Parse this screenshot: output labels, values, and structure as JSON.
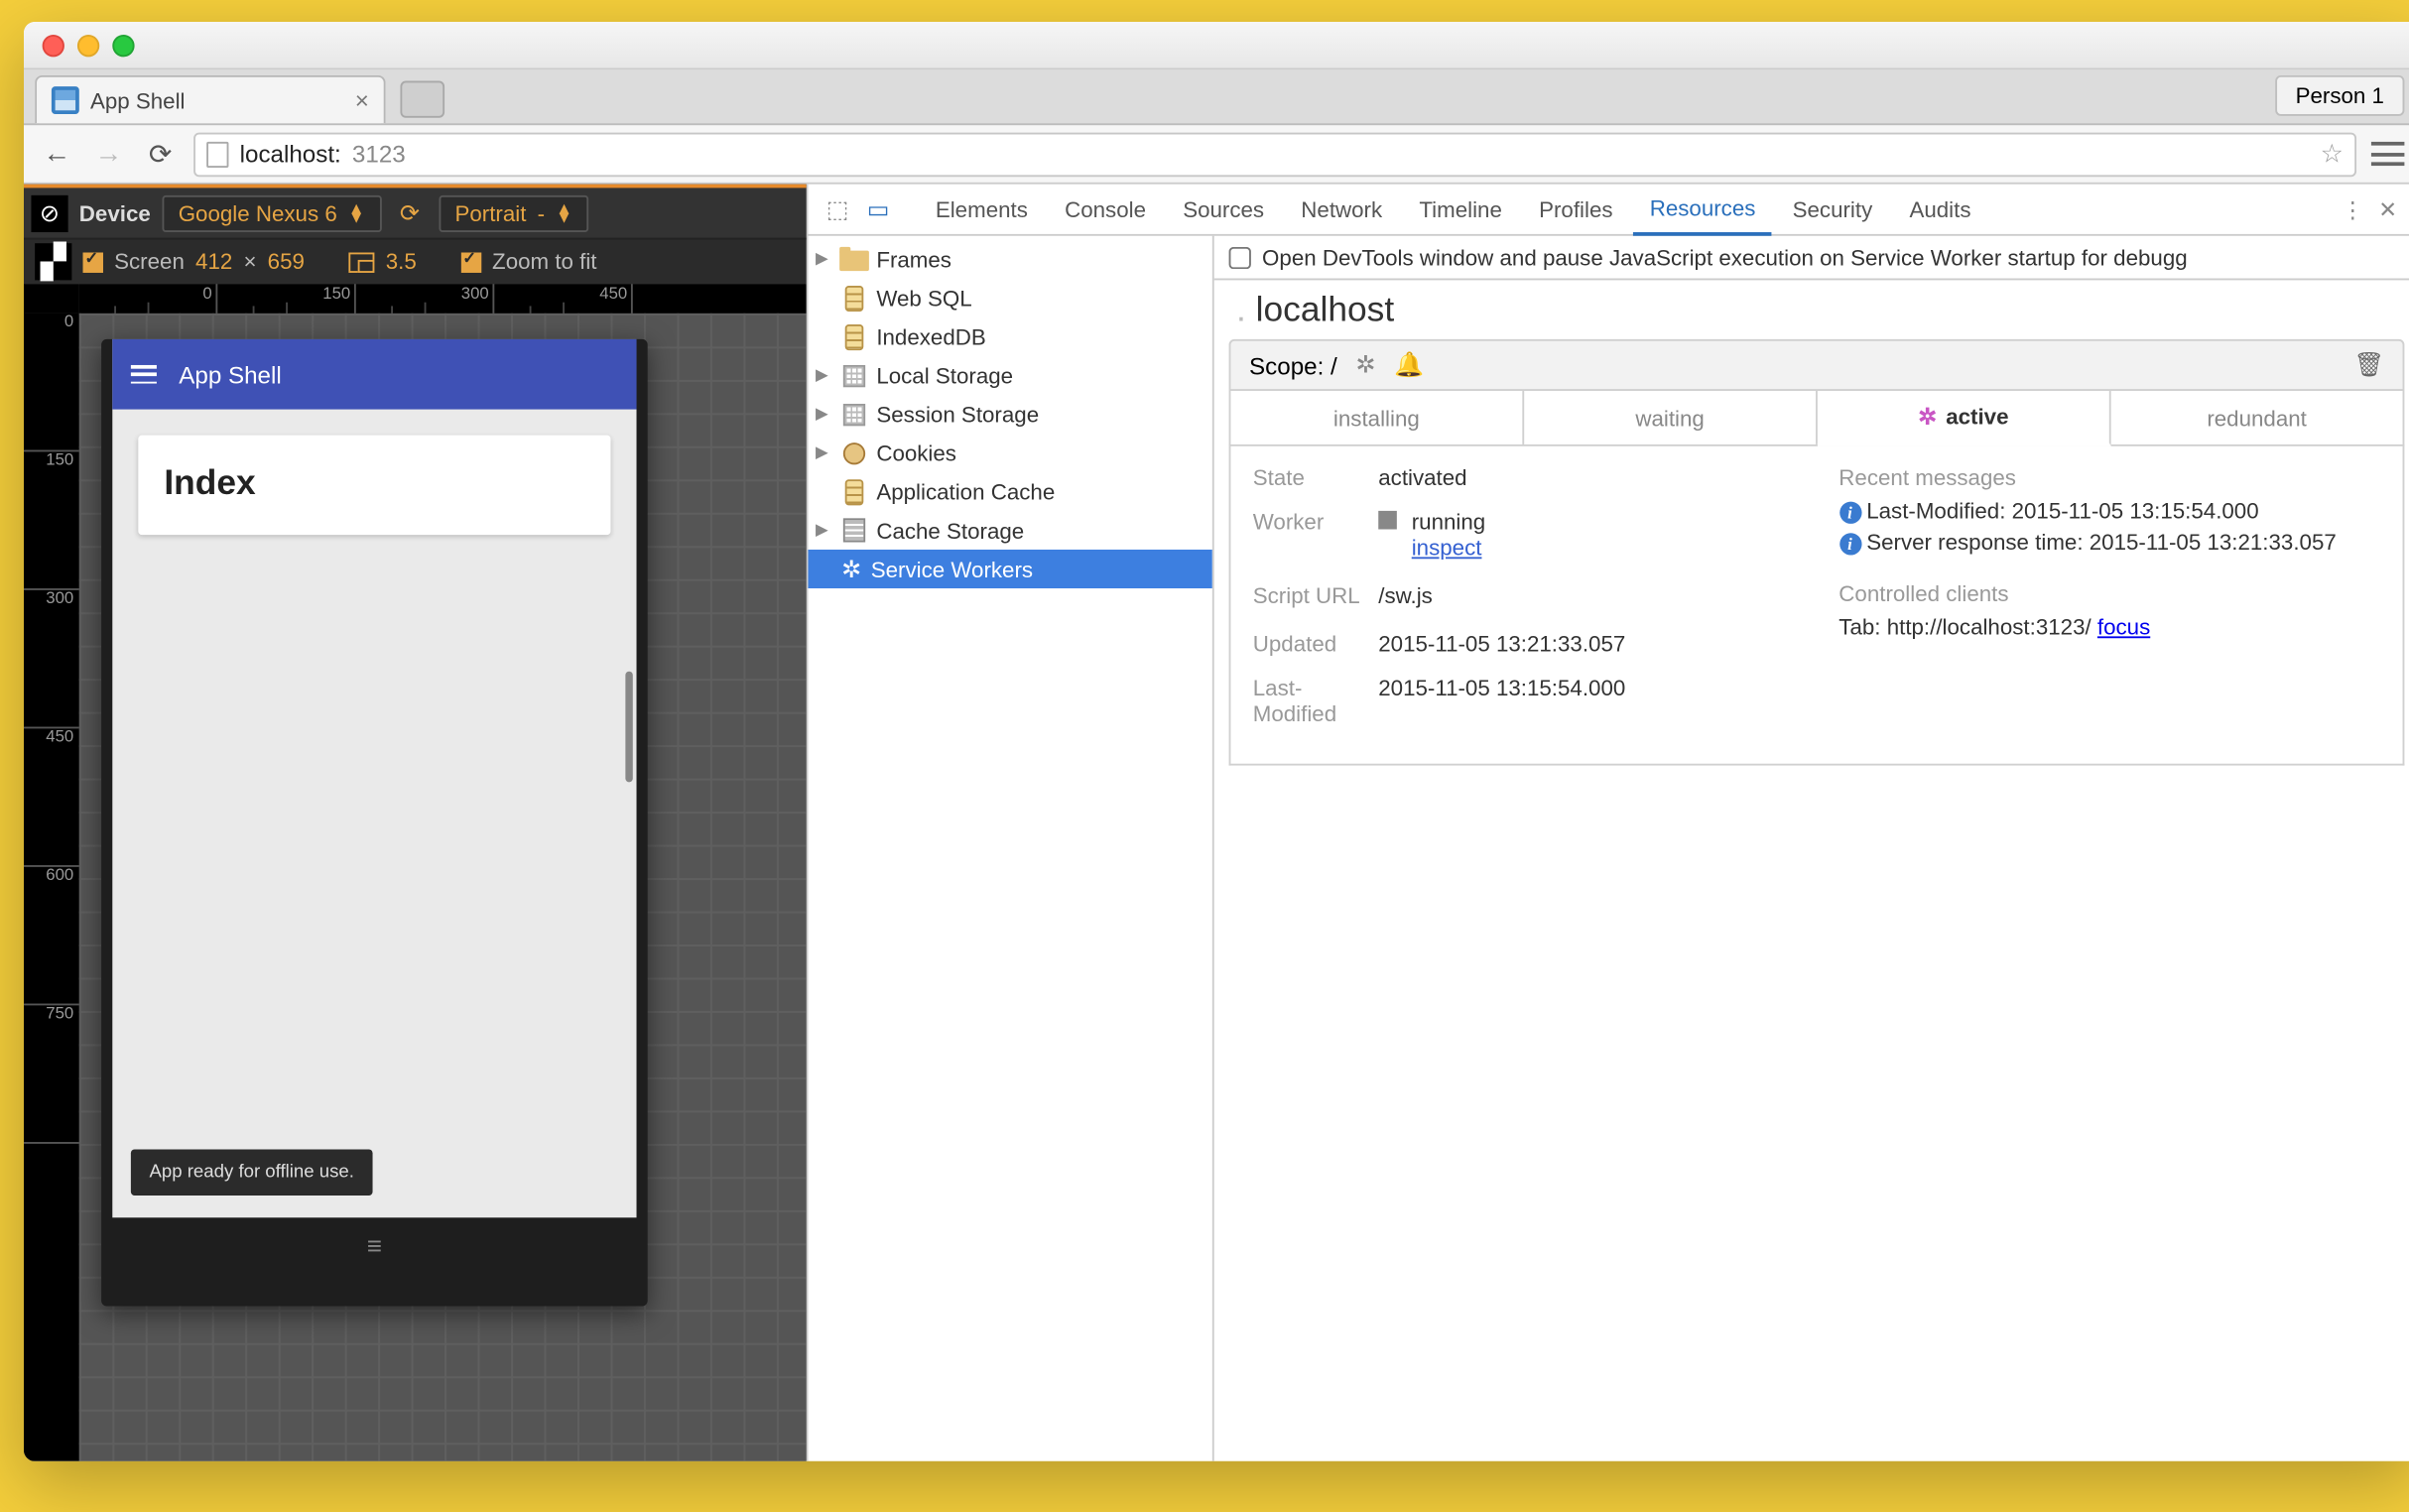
{
  "browser": {
    "tab_title": "App Shell",
    "person_label": "Person 1",
    "url_host": "localhost:",
    "url_port": "3123"
  },
  "device_toolbar": {
    "device_label": "Device",
    "device_value": "Google Nexus 6",
    "orientation": "Portrait",
    "screen_label": "Screen",
    "width": "412",
    "height": "659",
    "dpr": "3.5",
    "zoom_label": "Zoom to fit"
  },
  "ruler_h": [
    "0",
    "150",
    "300",
    "450"
  ],
  "ruler_v": [
    "0",
    "150",
    "300",
    "450",
    "600",
    "750"
  ],
  "preview": {
    "app_title": "App Shell",
    "card_title": "Index",
    "toast": "App ready for offline use."
  },
  "devtools": {
    "tabs": [
      "Elements",
      "Console",
      "Sources",
      "Network",
      "Timeline",
      "Profiles",
      "Resources",
      "Security",
      "Audits"
    ],
    "pause_text": "Open DevTools window and pause JavaScript execution on Service Worker startup for debugg",
    "tree": {
      "frames": "Frames",
      "websql": "Web SQL",
      "indexeddb": "IndexedDB",
      "localstorage": "Local Storage",
      "sessionstorage": "Session Storage",
      "cookies": "Cookies",
      "appcache": "Application Cache",
      "cachestorage": "Cache Storage",
      "sw": "Service Workers"
    },
    "origin": "localhost",
    "scope_label": "Scope: /",
    "sw_tabs": {
      "installing": "installing",
      "waiting": "waiting",
      "active": "active",
      "redundant": "redundant"
    },
    "sw": {
      "state_label": "State",
      "state_value": "activated",
      "worker_label": "Worker",
      "worker_status": "running",
      "worker_inspect": "inspect",
      "script_label": "Script URL",
      "script_value": "/sw.js",
      "updated_label": "Updated",
      "updated_value": "2015-11-05 13:21:33.057",
      "lastmod_label": "Last-Modified",
      "lastmod_value": "2015-11-05 13:15:54.000",
      "recent_label": "Recent messages",
      "msg1": "Last-Modified: 2015-11-05 13:15:54.000",
      "msg2": "Server response time: 2015-11-05 13:21:33.057",
      "clients_label": "Controlled clients",
      "client_prefix": "Tab: http://localhost:3123/ ",
      "client_focus": "focus"
    }
  }
}
